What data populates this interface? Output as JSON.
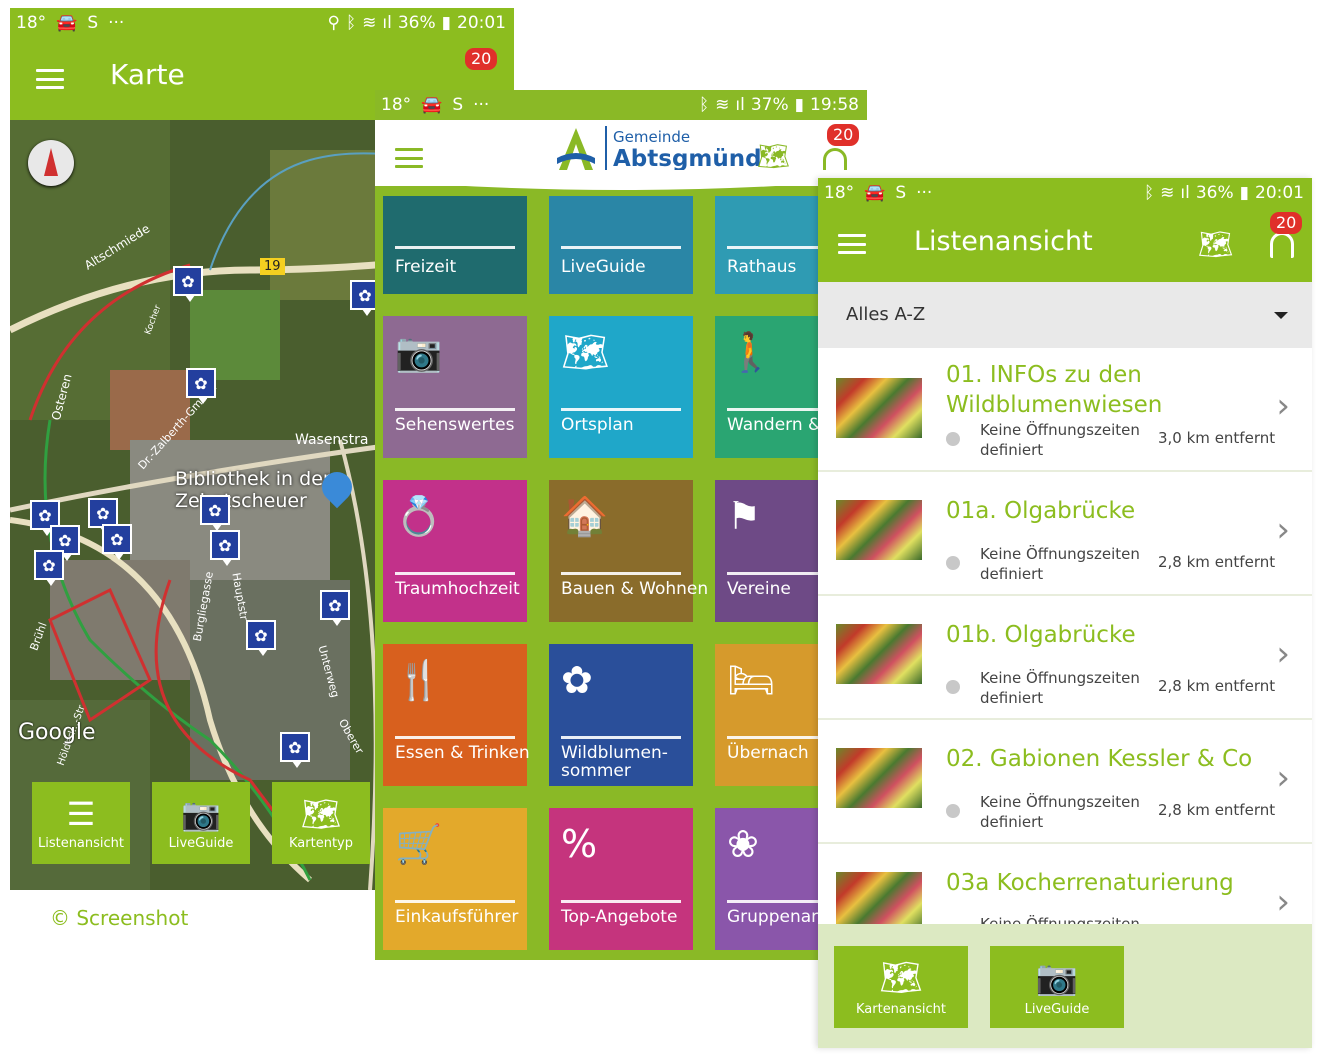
{
  "colors": {
    "green": "#8cbd1f",
    "badge": "#e0302a",
    "pin": "#233f9e"
  },
  "phone1": {
    "status": {
      "temp": "18°",
      "clock": "···",
      "battery": "36%",
      "time": "20:01"
    },
    "title": "Karte",
    "badge": "20",
    "map": {
      "road_label": "19",
      "streets": [
        "Altschmiede",
        "Kocher",
        "Osteren",
        "Wasenstra",
        "Dr.-Zalberth-Gmünd",
        "Brühl",
        "Burgliegasse",
        "Hauptstr",
        "Hölderl...-Str",
        "Unterweg",
        "Oberer"
      ],
      "poi": "Bibliothek in der\nZehntscheuer",
      "google": "Google"
    },
    "tabs": [
      {
        "icon": "list-icon",
        "label": "Listenansicht"
      },
      {
        "icon": "camera-icon",
        "label": "LiveGuide"
      },
      {
        "icon": "map-icon",
        "label": "Kartentyp"
      }
    ]
  },
  "phone2": {
    "status": {
      "temp": "18°",
      "clock": "···",
      "battery": "37%",
      "time": "19:58"
    },
    "logo": {
      "small": "Gemeinde",
      "big": "Abtsgmünd"
    },
    "badge": "20",
    "tiles": [
      {
        "label": "Freizeit",
        "color": "#1f6b6e",
        "icon": "leisure-icon"
      },
      {
        "label": "LiveGuide",
        "color": "#2a86a6",
        "icon": "liveguide-icon"
      },
      {
        "label": "Rathaus",
        "color": "#2f9bb3",
        "icon": "townhall-icon"
      },
      {
        "label": "Sehenswertes",
        "color": "#8e6a92",
        "icon": "camera-icon",
        "glyph": "📷"
      },
      {
        "label": "Ortsplan",
        "color": "#1fa7c9",
        "icon": "map-pin-icon",
        "glyph": "🗺"
      },
      {
        "label": "Wandern &",
        "color": "#2aa572",
        "icon": "hiking-icon",
        "glyph": "🚶"
      },
      {
        "label": "Traumhochzeit",
        "color": "#c2318a",
        "icon": "rings-icon",
        "glyph": "💍"
      },
      {
        "label": "Bauen & Wohnen",
        "color": "#8a6c2b",
        "icon": "house-icon",
        "glyph": "🏠"
      },
      {
        "label": "Vereine",
        "color": "#6e4a86",
        "icon": "flag-icon",
        "glyph": "⚑"
      },
      {
        "label": "Essen & Trinken",
        "color": "#d8601e",
        "icon": "cutlery-icon",
        "glyph": "🍴"
      },
      {
        "label": "Wildblumen-\nsommer",
        "color": "#2a4f9a",
        "icon": "flower-icon",
        "glyph": "✿"
      },
      {
        "label": "Übernach",
        "color": "#d69a2c",
        "icon": "bed-icon",
        "glyph": "🛏"
      },
      {
        "label": "Einkaufsführer",
        "color": "#e3a92b",
        "icon": "cart-icon",
        "glyph": "🛒"
      },
      {
        "label": "Top-Angebote",
        "color": "#c5347d",
        "icon": "bag-percent-icon",
        "glyph": "%"
      },
      {
        "label": "Gruppenang",
        "color": "#8a56aa",
        "icon": "rose-icon",
        "glyph": "❀"
      }
    ]
  },
  "phone3": {
    "status": {
      "temp": "18°",
      "clock": "···",
      "battery": "36%",
      "time": "20:01"
    },
    "title": "Listenansicht",
    "badge": "20",
    "filter": "Alles A-Z",
    "items": [
      {
        "title": "01. INFOs zu den Wildblumenwiesen",
        "hours": "Keine Öffnungszeiten definiert",
        "dist": "3,0 km entfernt"
      },
      {
        "title": "01a. Olgabrücke",
        "hours": "Keine Öffnungszeiten definiert",
        "dist": "2,8 km entfernt"
      },
      {
        "title": "01b. Olgabrücke",
        "hours": "Keine Öffnungszeiten definiert",
        "dist": "2,8 km entfernt"
      },
      {
        "title": "02. Gabionen Kessler & Co",
        "hours": "Keine Öffnungszeiten definiert",
        "dist": "2,8 km entfernt"
      },
      {
        "title": "03a Kocherrenaturierung",
        "hours": "Keine Öffnungszeiten",
        "dist": ""
      }
    ],
    "tabs": [
      {
        "icon": "map-icon",
        "label": "Kartenansicht"
      },
      {
        "icon": "camera-icon",
        "label": "LiveGuide"
      }
    ]
  },
  "caption": "© Screenshot"
}
